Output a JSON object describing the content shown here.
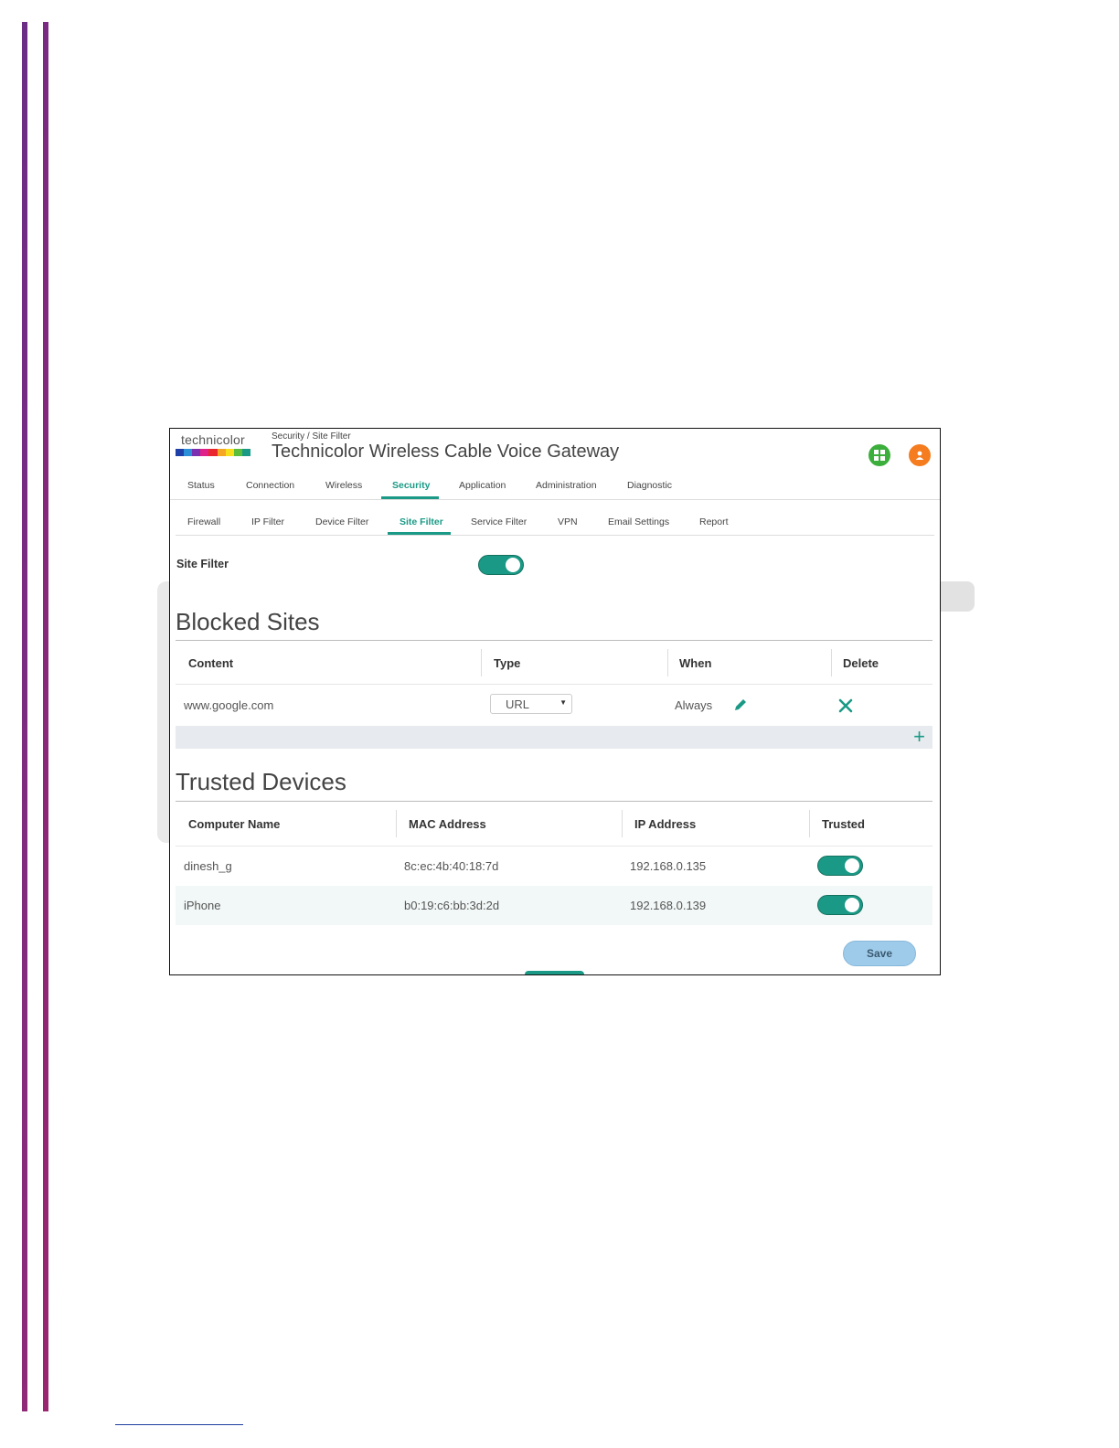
{
  "logo": {
    "text": "technicolor",
    "stripe_colors": [
      "#1e3fa8",
      "#2a8fd6",
      "#7a2fb0",
      "#e0218a",
      "#e8262b",
      "#f5a623",
      "#f7e01b",
      "#5cbd3a",
      "#1a9a86"
    ]
  },
  "header": {
    "breadcrumb": "Security / Site Filter",
    "title": "Technicolor Wireless Cable Voice Gateway",
    "icons": [
      "apps-grid-icon",
      "user-icon"
    ]
  },
  "nav": {
    "items": [
      "Status",
      "Connection",
      "Wireless",
      "Security",
      "Application",
      "Administration",
      "Diagnostic"
    ],
    "active": "Security"
  },
  "subnav": {
    "items": [
      "Firewall",
      "IP Filter",
      "Device Filter",
      "Site Filter",
      "Service Filter",
      "VPN",
      "Email Settings",
      "Report"
    ],
    "active": "Site Filter"
  },
  "site_filter": {
    "label": "Site Filter",
    "enabled": true
  },
  "blocked_sites": {
    "title": "Blocked Sites",
    "headers": [
      "Content",
      "Type",
      "When",
      "Delete"
    ],
    "rows": [
      {
        "content": "www.google.com",
        "type": "URL",
        "when": "Always"
      }
    ]
  },
  "trusted_devices": {
    "title": "Trusted Devices",
    "headers": [
      "Computer Name",
      "MAC Address",
      "IP Address",
      "Trusted"
    ],
    "rows": [
      {
        "name": "dinesh_g",
        "mac": "8c:ec:4b:40:18:7d",
        "ip": "192.168.0.135",
        "trusted": true
      },
      {
        "name": "iPhone",
        "mac": "b0:19:c6:bb:3d:2d",
        "ip": "192.168.0.139",
        "trusted": true
      }
    ]
  },
  "buttons": {
    "save": "Save"
  },
  "colors": {
    "accent": "#1a9a86",
    "save_button": "#9fcbea",
    "page_bar": "#7a2a82"
  }
}
